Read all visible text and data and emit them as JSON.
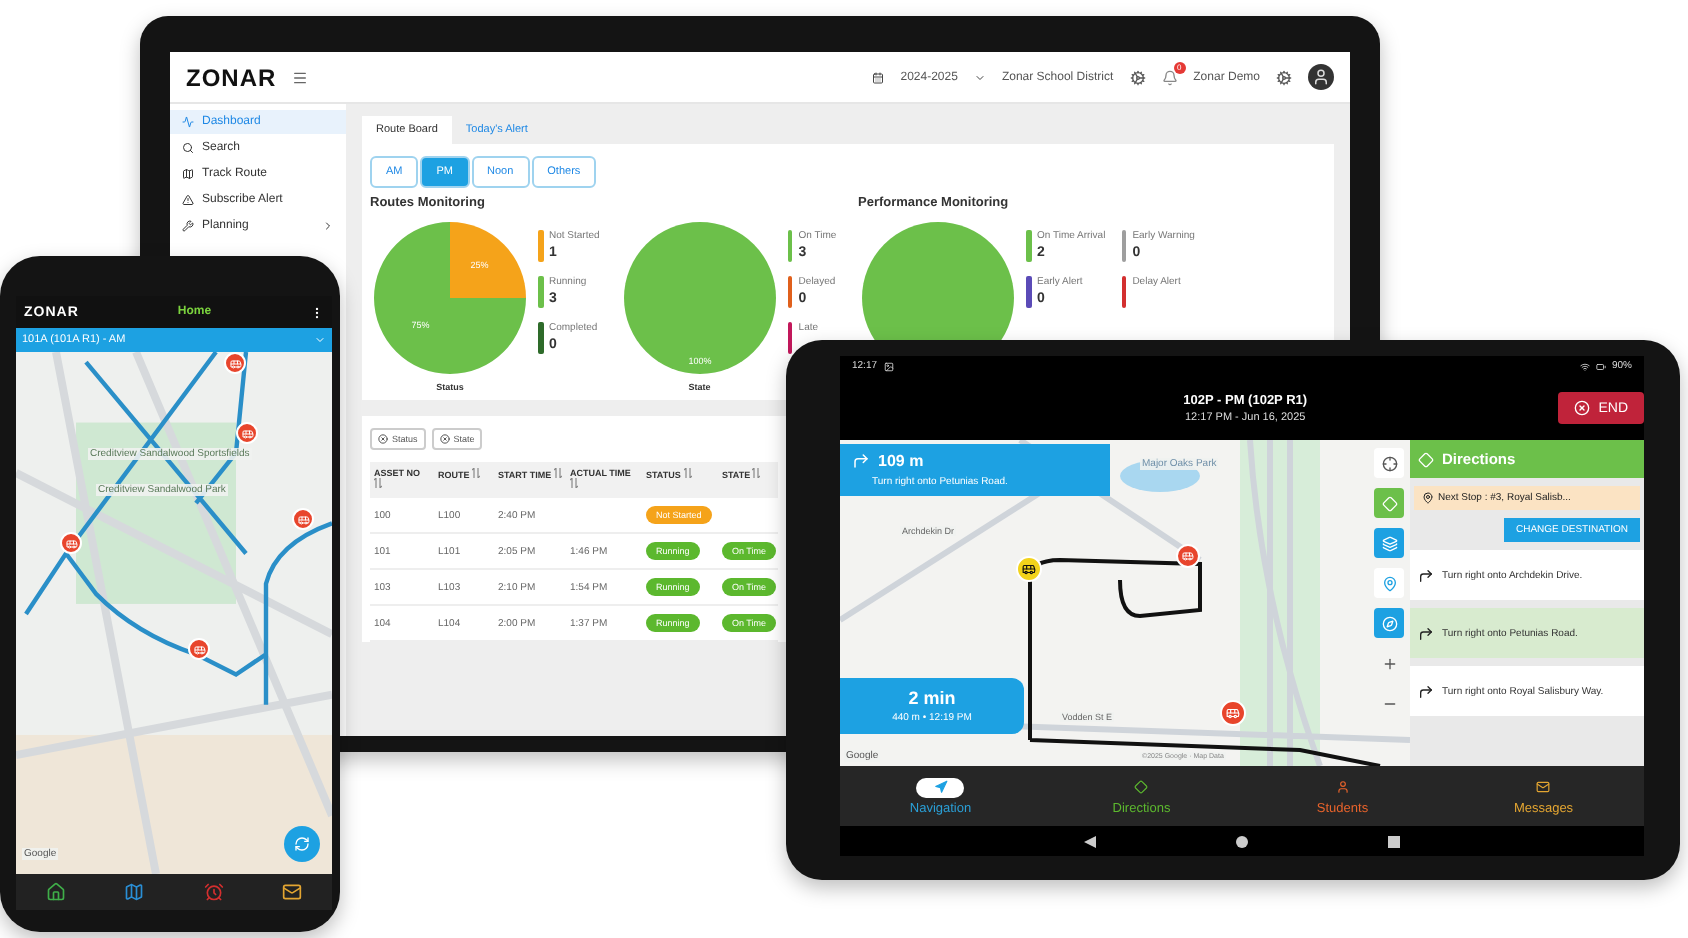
{
  "laptop": {
    "header": {
      "logo": "ZONAR",
      "school_year": "2024-2025",
      "district": "Zonar School District",
      "notification_count": "0",
      "user": "Zonar Demo"
    },
    "sidebar": {
      "items": [
        {
          "label": "Dashboard",
          "kind": "dashboard",
          "selected": true
        },
        {
          "label": "Search",
          "kind": "search",
          "selected": false
        },
        {
          "label": "Track Route",
          "kind": "track",
          "selected": false
        },
        {
          "label": "Subscribe Alert",
          "kind": "alert",
          "selected": false
        },
        {
          "label": "Planning",
          "kind": "planning",
          "selected": false
        }
      ]
    },
    "tabs": [
      {
        "label": "Route Board",
        "selected": true
      },
      {
        "label": "Today's Alert",
        "selected": false
      }
    ],
    "filters": [
      {
        "label": "AM",
        "selected": false
      },
      {
        "label": "PM",
        "selected": true
      },
      {
        "label": "Noon",
        "selected": false
      },
      {
        "label": "Others",
        "selected": false
      }
    ],
    "routes_monitoring": {
      "title": "Routes Monitoring",
      "charts": [
        {
          "chart_data": {
            "type": "pie",
            "title": "Status",
            "categories": [
              "Not Started",
              "Running",
              "Completed"
            ],
            "values": [
              25,
              75,
              0
            ],
            "value_labels": [
              "25%",
              "75%",
              null
            ]
          },
          "legend": [
            {
              "value": "1",
              "color": "#f5a31a"
            },
            {
              "value": "3",
              "color": "#6cc04a"
            },
            {
              "value": "0",
              "color": "#2e6b2a"
            }
          ]
        },
        {
          "chart_data": {
            "type": "pie",
            "title": "State",
            "categories": [
              "On Time",
              "Delayed",
              "Late"
            ],
            "values": [
              100,
              0,
              0
            ],
            "value_labels": [
              "100%",
              null,
              null
            ]
          },
          "legend": [
            {
              "value": "3",
              "color": "#6cc04a"
            },
            {
              "value": "0",
              "color": "#e0601c"
            },
            {
              "color": "#c2185b"
            }
          ]
        }
      ]
    },
    "performance_monitoring": {
      "title": "Performance Monitoring",
      "legend": [
        {
          "label": "On Time Arrival",
          "value": "2",
          "color": "#6cc04a"
        },
        {
          "label": "Early Warning",
          "value": "0",
          "color": "#9e9e9e"
        },
        {
          "label": "Early Alert",
          "value": "0",
          "color": "#5b4bb7"
        },
        {
          "label": "Delay Alert",
          "color": "#d32f2f"
        }
      ]
    },
    "table": {
      "chips": [
        "Status",
        "State"
      ],
      "columns": [
        "ASSET NO",
        "ROUTE",
        "START TIME",
        "ACTUAL TIME",
        "STATUS",
        "STATE"
      ],
      "rows": [
        {
          "asset_no": "100",
          "route": "L100",
          "start_time": "2:40 PM",
          "status": {
            "text": "Not Started",
            "kind": "not_started"
          }
        },
        {
          "asset_no": "101",
          "route": "L101",
          "start_time": "2:05 PM",
          "actual_time": "1:46 PM",
          "status": {
            "text": "Running",
            "kind": "running"
          },
          "state": "On Time"
        },
        {
          "asset_no": "103",
          "route": "L103",
          "start_time": "2:10 PM",
          "actual_time": "1:54 PM",
          "status": {
            "text": "Running",
            "kind": "running"
          },
          "state": "On Time"
        },
        {
          "asset_no": "104",
          "route": "L104",
          "start_time": "2:00 PM",
          "actual_time": "1:37 PM",
          "status": {
            "text": "Running",
            "kind": "running"
          },
          "state": "On Time"
        }
      ]
    }
  },
  "phone": {
    "logo": "ZONAR",
    "title": "Home",
    "route_select": "101A (101A R1) - AM",
    "map_labels": [
      "Creditview Sandalwood Sportsfields",
      "Creditview Sandalwood Park"
    ],
    "attribution": "Google",
    "nav": [
      {
        "kind": "home",
        "color": "#3fae49"
      },
      {
        "kind": "map",
        "color": "#2a8fd6"
      },
      {
        "kind": "alarm",
        "color": "#d32f2f"
      },
      {
        "kind": "mail",
        "color": "#e3a531"
      }
    ]
  },
  "tablet": {
    "status_time": "12:17",
    "battery": "90%",
    "title": "102P - PM (102P R1)",
    "subtitle": "12:17 PM - Jun 16, 2025",
    "end_button": "END",
    "next_turn": {
      "distance": "109 m",
      "instruction": "Turn right onto Petunias Road."
    },
    "eta": {
      "time": "2 min",
      "detail": "440 m • 12:19 PM"
    },
    "map_labels": [
      "Major Oaks Park",
      "Archdekin Dr",
      "Vodden St E"
    ],
    "attribution": "Google",
    "copyright": "©2025 Google · Map Data",
    "directions": {
      "title": "Directions",
      "next_stop": "Next Stop : #3, Royal Salisb...",
      "change_button": "CHANGE DESTINATION",
      "steps": [
        {
          "text": "Turn right onto Archdekin Drive.",
          "selected": false
        },
        {
          "text": "Turn right onto Petunias Road.",
          "selected": true
        },
        {
          "text": "Turn right onto Royal Salisbury Way.",
          "selected": false
        }
      ]
    },
    "nav": [
      {
        "label": "Navigation",
        "kind": "navigation",
        "selected": true,
        "color": "#2a9fd6"
      },
      {
        "label": "Directions",
        "kind": "directions",
        "selected": false,
        "color": "#5cb82e"
      },
      {
        "label": "Students",
        "kind": "students",
        "selected": false,
        "color": "#e8632b"
      },
      {
        "label": "Messages",
        "kind": "messages",
        "selected": false,
        "color": "#e3a531"
      }
    ]
  }
}
